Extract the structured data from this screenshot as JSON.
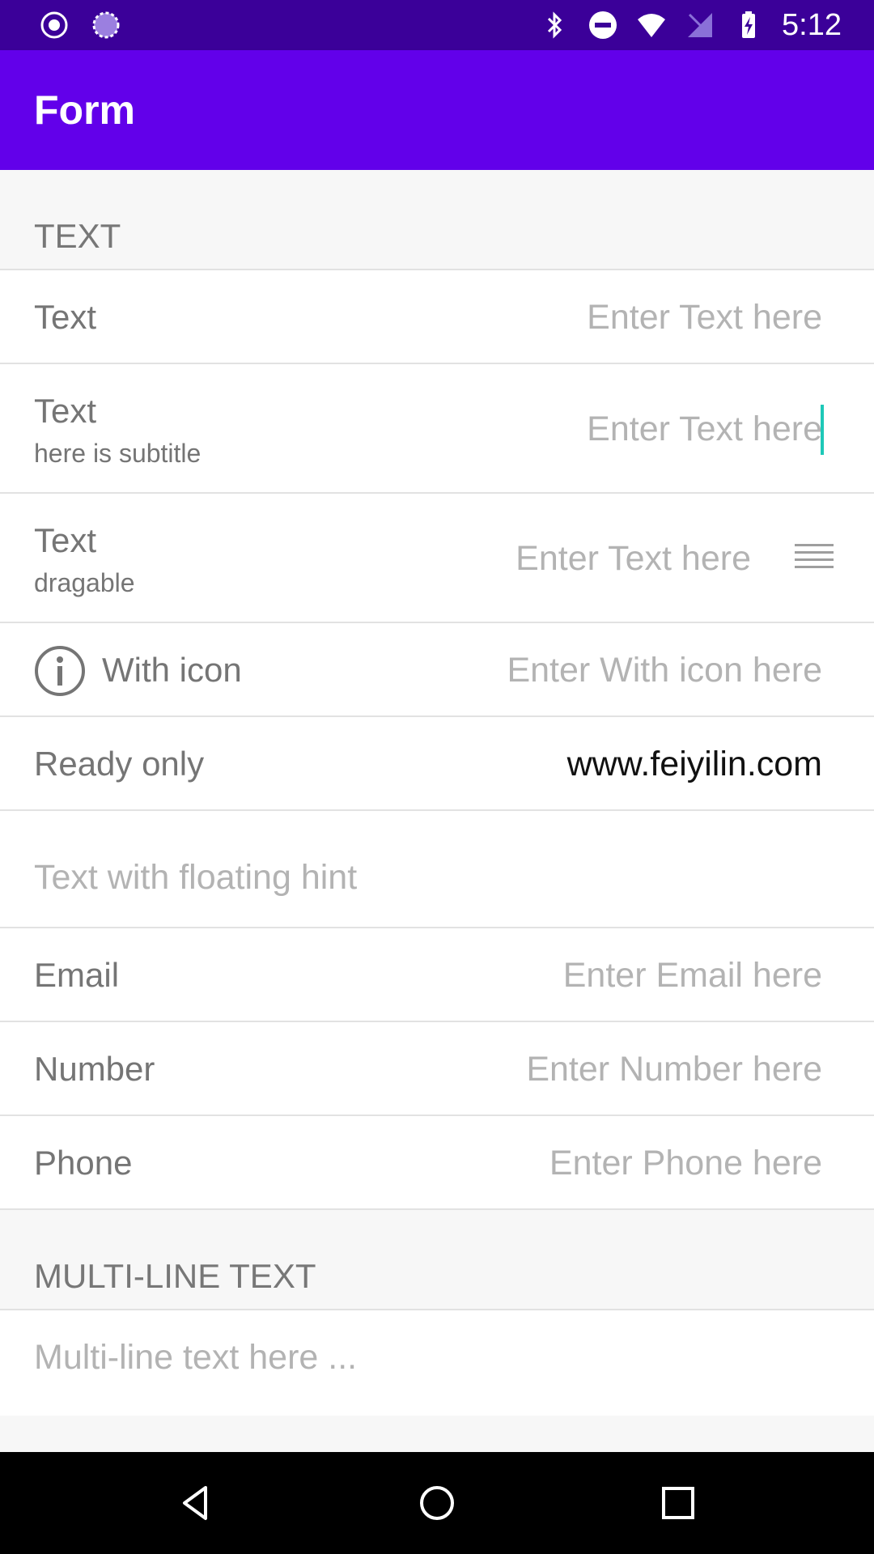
{
  "status_bar": {
    "time": "5:12",
    "left_icons": [
      "record-icon",
      "loading-icon"
    ],
    "right_icons": [
      "bluetooth-icon",
      "do-not-disturb-icon",
      "wifi-icon",
      "no-signal-icon",
      "battery-charging-icon"
    ]
  },
  "app_bar": {
    "title": "Form"
  },
  "sections": {
    "text_header": "TEXT",
    "multiline_header": "MULTI-LINE TEXT"
  },
  "rows": {
    "text": {
      "label": "Text",
      "placeholder": "Enter Text here"
    },
    "text_subtitle": {
      "label": "Text",
      "subtitle": "here is subtitle",
      "placeholder": "Enter Text here"
    },
    "text_dragable": {
      "label": "Text",
      "subtitle": "dragable",
      "placeholder": "Enter Text here"
    },
    "with_icon": {
      "label": "With icon",
      "placeholder": "Enter With icon here"
    },
    "read_only": {
      "label": "Ready only",
      "value": "www.feiyilin.com"
    },
    "floating_hint": {
      "hint": "Text with floating hint"
    },
    "email": {
      "label": "Email",
      "placeholder": "Enter Email here"
    },
    "number": {
      "label": "Number",
      "placeholder": "Enter Number here"
    },
    "phone": {
      "label": "Phone",
      "placeholder": "Enter Phone here"
    },
    "multiline": {
      "placeholder": "Multi-line text here ..."
    }
  },
  "colors": {
    "status_bar": "#3b0099",
    "app_bar": "#6200ea",
    "cursor": "#1ec8b8"
  }
}
